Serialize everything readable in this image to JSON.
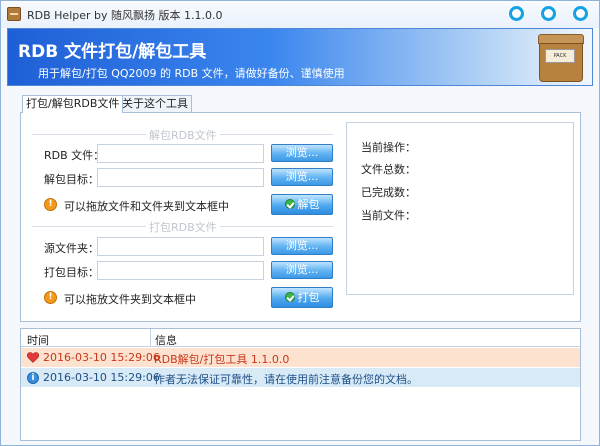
{
  "window": {
    "title": "RDB Helper by 随风飘扬 版本 1.1.0.0"
  },
  "banner": {
    "title": "RDB 文件打包/解包工具",
    "subtitle": "用于解包/打包 QQ2009 的 RDB 文件，请做好备份、谨慎使用",
    "logo_label": "PACK ARCHIVE"
  },
  "tabs": [
    {
      "label": "打包/解包RDB文件",
      "active": true
    },
    {
      "label": "关于这个工具",
      "active": false
    }
  ],
  "unpack": {
    "section_title": "解包RDB文件",
    "rdb_file_label": "RDB 文件：",
    "rdb_file_value": "",
    "target_label": "解包目标：",
    "target_value": "",
    "browse_label": "浏览...",
    "hint": "可以拖放文件和文件夹到文本框中",
    "action_label": "解包"
  },
  "pack": {
    "section_title": "打包RDB文件",
    "source_label": "源文件夹：",
    "source_value": "",
    "target_label": "打包目标：",
    "target_value": "",
    "browse_label": "浏览...",
    "hint": "可以拖放文件夹到文本框中",
    "action_label": "打包"
  },
  "status": {
    "current_op": "当前操作：",
    "total_files": "文件总数：",
    "done_count": "已完成数：",
    "current_file": "当前文件："
  },
  "log": {
    "col_time": "时间",
    "col_info": "信息",
    "rows": [
      {
        "time": "2016-03-10 15:29:06",
        "msg": "RDB解包/打包工具 1.1.0.0",
        "type": "heart"
      },
      {
        "time": "2016-03-10 15:29:06",
        "msg": "作者无法保证可靠性，请在使用前注意备份您的文档。",
        "type": "info"
      }
    ]
  },
  "colors": {
    "accent": "#17a0e6",
    "row_highlight": "#fde3cf",
    "row_selected": "#d9eaf7",
    "log_red": "#c8361b",
    "log_blue": "#1d4f86"
  }
}
